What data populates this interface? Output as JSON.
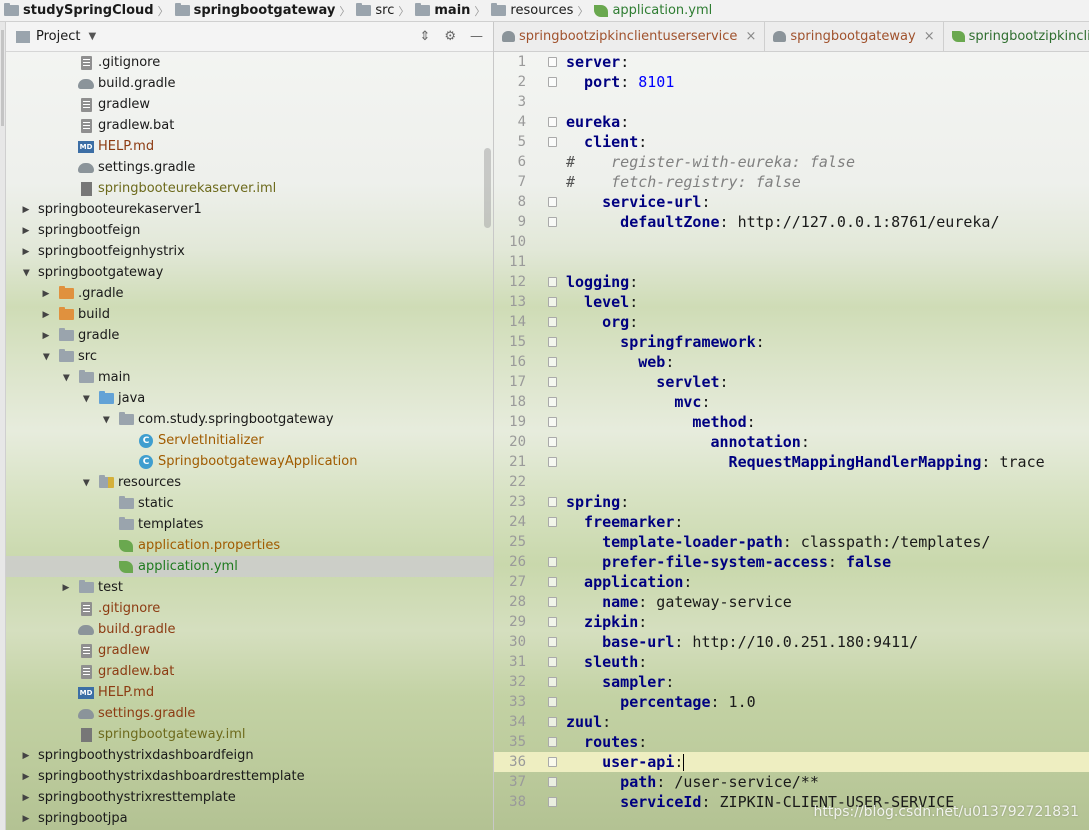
{
  "breadcrumb": [
    {
      "label": "studySpringCloud",
      "style": "bold"
    },
    {
      "label": "springbootgateway",
      "style": "bold"
    },
    {
      "label": "src",
      "style": "normal"
    },
    {
      "label": "main",
      "style": "bold"
    },
    {
      "label": "resources",
      "style": "normal"
    },
    {
      "label": "application.yml",
      "style": "green"
    }
  ],
  "project_panel": {
    "title": "Project",
    "icons": [
      "collapse-icon",
      "gear-icon",
      "hide-icon"
    ]
  },
  "tree": [
    {
      "label": ".gitignore",
      "icon": "file-icon",
      "indent": 3,
      "expand": "none",
      "color": "default"
    },
    {
      "label": "build.gradle",
      "icon": "gradle-icon",
      "indent": 3,
      "expand": "none",
      "color": "default"
    },
    {
      "label": "gradlew",
      "icon": "file-icon",
      "indent": 3,
      "expand": "none",
      "color": "default"
    },
    {
      "label": "gradlew.bat",
      "icon": "file-icon",
      "indent": 3,
      "expand": "none",
      "color": "default"
    },
    {
      "label": "HELP.md",
      "icon": "md-icon",
      "indent": 3,
      "expand": "none",
      "color": "brown"
    },
    {
      "label": "settings.gradle",
      "icon": "gradle-icon",
      "indent": 3,
      "expand": "none",
      "color": "default"
    },
    {
      "label": "springbooteurekaserver.iml",
      "icon": "iml-icon",
      "indent": 3,
      "expand": "none",
      "color": "olive"
    },
    {
      "label": "springbooteurekaserver1",
      "icon": "none",
      "indent": 1,
      "expand": "closed",
      "color": "default"
    },
    {
      "label": "springbootfeign",
      "icon": "none",
      "indent": 1,
      "expand": "closed",
      "color": "default"
    },
    {
      "label": "springbootfeignhystrix",
      "icon": "none",
      "indent": 1,
      "expand": "closed",
      "color": "default"
    },
    {
      "label": "springbootgateway",
      "icon": "none",
      "indent": 1,
      "expand": "open",
      "color": "default"
    },
    {
      "label": ".gradle",
      "icon": "folder-orange-icon",
      "indent": 2,
      "expand": "closed",
      "color": "default"
    },
    {
      "label": "build",
      "icon": "folder-orange-icon",
      "indent": 2,
      "expand": "closed",
      "color": "default"
    },
    {
      "label": "gradle",
      "icon": "folder-icon",
      "indent": 2,
      "expand": "closed",
      "color": "default"
    },
    {
      "label": "src",
      "icon": "folder-icon",
      "indent": 2,
      "expand": "open",
      "color": "default"
    },
    {
      "label": "main",
      "icon": "folder-icon",
      "indent": 3,
      "expand": "open",
      "color": "default"
    },
    {
      "label": "java",
      "icon": "folder-blue-icon",
      "indent": 4,
      "expand": "open",
      "color": "default"
    },
    {
      "label": "com.study.springbootgateway",
      "icon": "package-icon",
      "indent": 5,
      "expand": "open",
      "color": "default"
    },
    {
      "label": "ServletInitializer",
      "icon": "class-icon",
      "indent": 6,
      "expand": "none",
      "color": "orange"
    },
    {
      "label": "SpringbootgatewayApplication",
      "icon": "class-icon",
      "indent": 6,
      "expand": "none",
      "color": "orange"
    },
    {
      "label": "resources",
      "icon": "folder-res-icon",
      "indent": 4,
      "expand": "open",
      "color": "default"
    },
    {
      "label": "static",
      "icon": "folder-icon",
      "indent": 5,
      "expand": "none",
      "color": "default"
    },
    {
      "label": "templates",
      "icon": "folder-icon",
      "indent": 5,
      "expand": "none",
      "color": "default"
    },
    {
      "label": "application.properties",
      "icon": "spring-leaf-icon",
      "indent": 5,
      "expand": "none",
      "color": "orange"
    },
    {
      "label": "application.yml",
      "icon": "spring-leaf-icon",
      "indent": 5,
      "expand": "none",
      "color": "green",
      "selected": true
    },
    {
      "label": "test",
      "icon": "folder-icon",
      "indent": 3,
      "expand": "closed",
      "color": "default"
    },
    {
      "label": ".gitignore",
      "icon": "file-icon",
      "indent": 3,
      "expand": "none",
      "color": "brown"
    },
    {
      "label": "build.gradle",
      "icon": "gradle-icon",
      "indent": 3,
      "expand": "none",
      "color": "brown"
    },
    {
      "label": "gradlew",
      "icon": "file-icon",
      "indent": 3,
      "expand": "none",
      "color": "brown"
    },
    {
      "label": "gradlew.bat",
      "icon": "file-icon",
      "indent": 3,
      "expand": "none",
      "color": "brown"
    },
    {
      "label": "HELP.md",
      "icon": "md-icon",
      "indent": 3,
      "expand": "none",
      "color": "brown"
    },
    {
      "label": "settings.gradle",
      "icon": "gradle-icon",
      "indent": 3,
      "expand": "none",
      "color": "brown"
    },
    {
      "label": "springbootgateway.iml",
      "icon": "iml-icon",
      "indent": 3,
      "expand": "none",
      "color": "olive"
    },
    {
      "label": "springboothystrixdashboardfeign",
      "icon": "none",
      "indent": 1,
      "expand": "closed",
      "color": "default"
    },
    {
      "label": "springboothystrixdashboardresttemplate",
      "icon": "none",
      "indent": 1,
      "expand": "closed",
      "color": "default"
    },
    {
      "label": "springboothystrixresttemplate",
      "icon": "none",
      "indent": 1,
      "expand": "closed",
      "color": "default"
    },
    {
      "label": "springbootjpa",
      "icon": "none",
      "indent": 1,
      "expand": "closed",
      "color": "default"
    }
  ],
  "editor_tabs": [
    {
      "label": "springbootzipkinclientuserservice",
      "icon": "gradle-icon",
      "closable": true,
      "kind": "gradle"
    },
    {
      "label": "springbootgateway",
      "icon": "gradle-icon",
      "closable": true,
      "kind": "gradle"
    },
    {
      "label": "springbootzipkinclientuserse",
      "icon": "spring-leaf-icon",
      "closable": false,
      "kind": "yml"
    }
  ],
  "code_lines": [
    {
      "n": "1",
      "tokens": [
        {
          "t": "server",
          "c": "k"
        },
        {
          "t": ":",
          "c": "p"
        }
      ],
      "fold": true
    },
    {
      "n": "2",
      "tokens": [
        {
          "t": "  port",
          "c": "k"
        },
        {
          "t": ": ",
          "c": "p"
        },
        {
          "t": "8101",
          "c": "num"
        }
      ],
      "fold": true
    },
    {
      "n": "3",
      "tokens": []
    },
    {
      "n": "4",
      "tokens": [
        {
          "t": "eureka",
          "c": "k"
        },
        {
          "t": ":",
          "c": "p"
        }
      ],
      "fold": true
    },
    {
      "n": "5",
      "tokens": [
        {
          "t": "  client",
          "c": "k"
        },
        {
          "t": ":",
          "c": "p"
        }
      ],
      "fold": true
    },
    {
      "n": "6",
      "tokens": [
        {
          "t": "#",
          "c": "hash"
        },
        {
          "t": "    register-with-eureka: false",
          "c": "cmt"
        }
      ]
    },
    {
      "n": "7",
      "tokens": [
        {
          "t": "#",
          "c": "hash"
        },
        {
          "t": "    fetch-registry: false",
          "c": "cmt"
        }
      ]
    },
    {
      "n": "8",
      "tokens": [
        {
          "t": "    service-url",
          "c": "k"
        },
        {
          "t": ":",
          "c": "p"
        }
      ],
      "fold": true
    },
    {
      "n": "9",
      "tokens": [
        {
          "t": "      defaultZone",
          "c": "k"
        },
        {
          "t": ": http://127.0.0.1:8761/eureka/",
          "c": "p"
        }
      ],
      "fold": true
    },
    {
      "n": "10",
      "tokens": []
    },
    {
      "n": "11",
      "tokens": []
    },
    {
      "n": "12",
      "tokens": [
        {
          "t": "logging",
          "c": "k"
        },
        {
          "t": ":",
          "c": "p"
        }
      ],
      "fold": true
    },
    {
      "n": "13",
      "tokens": [
        {
          "t": "  level",
          "c": "k"
        },
        {
          "t": ":",
          "c": "p"
        }
      ],
      "fold": true
    },
    {
      "n": "14",
      "tokens": [
        {
          "t": "    org",
          "c": "k"
        },
        {
          "t": ":",
          "c": "p"
        }
      ],
      "fold": true
    },
    {
      "n": "15",
      "tokens": [
        {
          "t": "      springframework",
          "c": "k"
        },
        {
          "t": ":",
          "c": "p"
        }
      ],
      "fold": true
    },
    {
      "n": "16",
      "tokens": [
        {
          "t": "        web",
          "c": "k"
        },
        {
          "t": ":",
          "c": "p"
        }
      ],
      "fold": true
    },
    {
      "n": "17",
      "tokens": [
        {
          "t": "          servlet",
          "c": "k"
        },
        {
          "t": ":",
          "c": "p"
        }
      ],
      "fold": true
    },
    {
      "n": "18",
      "tokens": [
        {
          "t": "            mvc",
          "c": "k"
        },
        {
          "t": ":",
          "c": "p"
        }
      ],
      "fold": true
    },
    {
      "n": "19",
      "tokens": [
        {
          "t": "              method",
          "c": "k"
        },
        {
          "t": ":",
          "c": "p"
        }
      ],
      "fold": true
    },
    {
      "n": "20",
      "tokens": [
        {
          "t": "                annotation",
          "c": "k"
        },
        {
          "t": ":",
          "c": "p"
        }
      ],
      "fold": true
    },
    {
      "n": "21",
      "tokens": [
        {
          "t": "                  RequestMappingHandlerMapping",
          "c": "k"
        },
        {
          "t": ": trace",
          "c": "p"
        }
      ],
      "fold": true
    },
    {
      "n": "22",
      "tokens": []
    },
    {
      "n": "23",
      "tokens": [
        {
          "t": "spring",
          "c": "k"
        },
        {
          "t": ":",
          "c": "p"
        }
      ],
      "fold": true
    },
    {
      "n": "24",
      "tokens": [
        {
          "t": "  freemarker",
          "c": "k"
        },
        {
          "t": ":",
          "c": "p"
        }
      ],
      "fold": true
    },
    {
      "n": "25",
      "tokens": [
        {
          "t": "    template-loader-path",
          "c": "k"
        },
        {
          "t": ": classpath:/templates/",
          "c": "p"
        }
      ]
    },
    {
      "n": "26",
      "tokens": [
        {
          "t": "    prefer-file-system-access",
          "c": "k"
        },
        {
          "t": ": ",
          "c": "p"
        },
        {
          "t": "false",
          "c": "bool"
        }
      ],
      "fold": true
    },
    {
      "n": "27",
      "tokens": [
        {
          "t": "  application",
          "c": "k"
        },
        {
          "t": ":",
          "c": "p"
        }
      ],
      "fold": true
    },
    {
      "n": "28",
      "tokens": [
        {
          "t": "    name",
          "c": "k"
        },
        {
          "t": ": gateway-service",
          "c": "p"
        }
      ],
      "fold": true
    },
    {
      "n": "29",
      "tokens": [
        {
          "t": "  zipkin",
          "c": "k"
        },
        {
          "t": ":",
          "c": "p"
        }
      ],
      "fold": true
    },
    {
      "n": "30",
      "tokens": [
        {
          "t": "    base-url",
          "c": "k"
        },
        {
          "t": ": http://10.0.251.180:9411/",
          "c": "p"
        }
      ],
      "fold": true
    },
    {
      "n": "31",
      "tokens": [
        {
          "t": "  sleuth",
          "c": "k"
        },
        {
          "t": ":",
          "c": "p"
        }
      ],
      "fold": true
    },
    {
      "n": "32",
      "tokens": [
        {
          "t": "    sampler",
          "c": "k"
        },
        {
          "t": ":",
          "c": "p"
        }
      ],
      "fold": true
    },
    {
      "n": "33",
      "tokens": [
        {
          "t": "      percentage",
          "c": "k"
        },
        {
          "t": ": 1.0",
          "c": "p"
        }
      ],
      "fold": true
    },
    {
      "n": "34",
      "tokens": [
        {
          "t": "zuul",
          "c": "k"
        },
        {
          "t": ":",
          "c": "p"
        }
      ],
      "fold": true
    },
    {
      "n": "35",
      "tokens": [
        {
          "t": "  routes",
          "c": "k"
        },
        {
          "t": ":",
          "c": "p"
        }
      ],
      "fold": true
    },
    {
      "n": "36",
      "tokens": [
        {
          "t": "    user-api",
          "c": "k"
        },
        {
          "t": ":",
          "c": "p"
        }
      ],
      "fold": true,
      "current": true,
      "caret": true
    },
    {
      "n": "37",
      "tokens": [
        {
          "t": "      path",
          "c": "k"
        },
        {
          "t": ": /user-service/**",
          "c": "p"
        }
      ],
      "fold": true
    },
    {
      "n": "38",
      "tokens": [
        {
          "t": "      serviceId",
          "c": "k"
        },
        {
          "t": ": ZIPKIN-CLIENT-USER-SERVICE",
          "c": "p"
        }
      ],
      "fold": true
    }
  ],
  "watermark": "https://blog.csdn.net/u013792721831",
  "colors": {
    "key": "#000080",
    "number": "#0000ff",
    "comment": "#808080",
    "modified_file": "#8c3b12",
    "selected_row": "#cdcdcd",
    "current_line": "#fffacd"
  }
}
